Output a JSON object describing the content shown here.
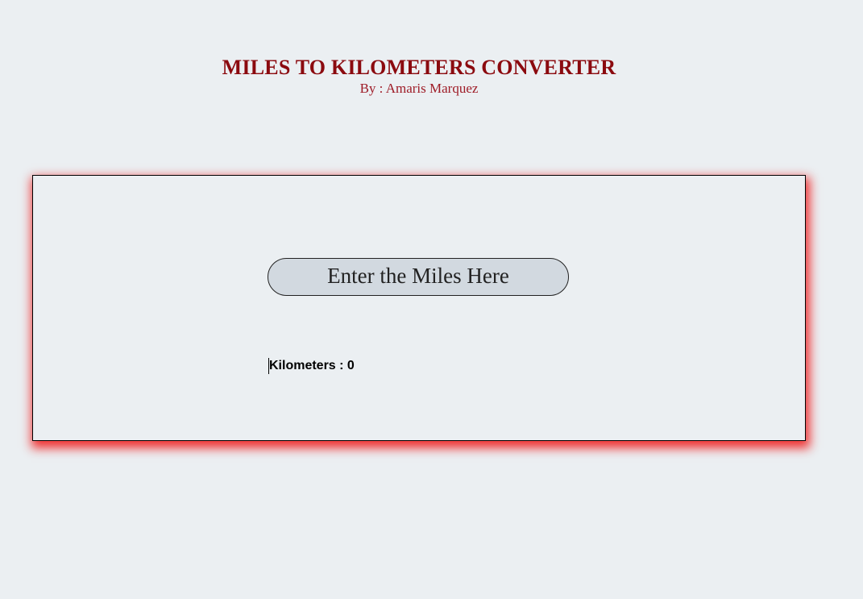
{
  "header": {
    "title": "MILES TO KILOMETERS CONVERTER",
    "byline": "By : Amaris Marquez"
  },
  "converter": {
    "input_placeholder": "Enter the Miles Here",
    "input_value": "",
    "result_label": "Kilometers",
    "result_separator": " : ",
    "result_value": "0"
  },
  "colors": {
    "title": "#8b0a0f",
    "byline": "#9e1c27",
    "page_background": "#ebeff2",
    "input_background": "#d2d9e0",
    "card_shadow": "#f01414"
  }
}
